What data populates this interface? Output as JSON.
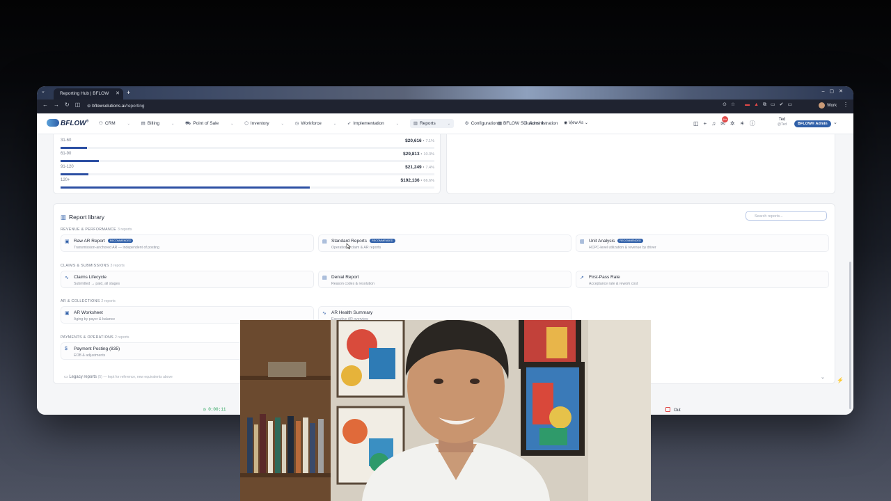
{
  "browser": {
    "tab_title": "Reporting Hub | BFLOW",
    "url_domain": "bflowsolutions.ai",
    "url_path": "/reporting",
    "profile_label": "Work"
  },
  "app": {
    "logo_text": "BFLOW",
    "logo_mark": "®",
    "menu": [
      {
        "label": "CRM",
        "icon": "people-icon"
      },
      {
        "label": "Billing",
        "icon": "billing-icon"
      },
      {
        "label": "Point of Sale",
        "icon": "cart-icon"
      },
      {
        "label": "Inventory",
        "icon": "box-icon"
      },
      {
        "label": "Workforce",
        "icon": "clock-icon"
      },
      {
        "label": "Implementation",
        "icon": "rocket-icon"
      },
      {
        "label": "Reports",
        "icon": "chart-icon"
      },
      {
        "label": "Configuration",
        "icon": "gear-icon"
      },
      {
        "label": "Administration",
        "icon": "shield-icon"
      }
    ],
    "org_name": "BFLOW Solutions",
    "view_as": "View As",
    "user_name": "Ted",
    "user_handle": "@Ted",
    "role_badge": "BFLOW® Admin",
    "notification_count": "99+"
  },
  "aging": [
    {
      "label": "31-60",
      "amount": "$20,616",
      "pct": "7.1%",
      "share": 0.071
    },
    {
      "label": "61-90",
      "amount": "$29,813",
      "pct": "10.3%",
      "share": 0.103
    },
    {
      "label": "91-120",
      "amount": "$21,249",
      "pct": "7.4%",
      "share": 0.074
    },
    {
      "label": "120+",
      "amount": "$192,136",
      "pct": "66.6%",
      "share": 0.666
    }
  ],
  "library": {
    "title": "Report library",
    "search_placeholder": "Search reports...",
    "recommended_label": "RECOMMENDED",
    "sections": [
      {
        "title": "REVENUE & PERFORMANCE",
        "count": "3 reports",
        "items": [
          {
            "name": "Raw AR Report",
            "desc": "Transmission-anchored AR — independent of posting",
            "recommended": true,
            "icon": "document-icon"
          },
          {
            "name": "Standard Reports",
            "desc": "Operational claim & AR reports",
            "recommended": true,
            "icon": "document-icon"
          },
          {
            "name": "Unit Analysis",
            "desc": "HCPC-level utilization & revenue by driver",
            "recommended": true,
            "icon": "bar-chart-icon"
          }
        ]
      },
      {
        "title": "CLAIMS & SUBMISSIONS",
        "count": "3 reports",
        "items": [
          {
            "name": "Claims Lifecycle",
            "desc": "Submitted → paid, all stages",
            "recommended": false,
            "icon": "pulse-icon"
          },
          {
            "name": "Denial Report",
            "desc": "Reason codes & resolution",
            "recommended": false,
            "icon": "document-icon"
          },
          {
            "name": "First-Pass Rate",
            "desc": "Acceptance rate & rework cost",
            "recommended": false,
            "icon": "trend-icon"
          }
        ]
      },
      {
        "title": "AR & COLLECTIONS",
        "count": "2 reports",
        "items": [
          {
            "name": "AR Worksheet",
            "desc": "Aging by payer & balance",
            "recommended": false,
            "icon": "table-icon"
          },
          {
            "name": "AR Health Summary",
            "desc": "Executive AR overview",
            "recommended": false,
            "icon": "pulse-icon"
          }
        ]
      },
      {
        "title": "PAYMENTS & OPERATIONS",
        "count": "2 reports",
        "items": [
          {
            "name": "Payment Posting (835)",
            "desc": "EOB & adjustments",
            "recommended": false,
            "icon": "dollar-icon"
          }
        ]
      }
    ],
    "legacy_label": "Legacy reports",
    "legacy_count": "(5)",
    "legacy_note": "— kept for reference, new equivalents above"
  },
  "footer": {
    "timer": "0:00:11",
    "partial_left": "k",
    "clock_out": "Out"
  }
}
